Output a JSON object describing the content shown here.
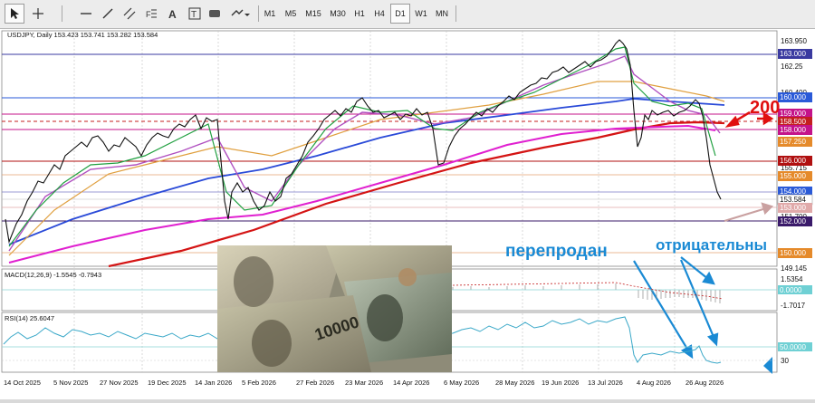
{
  "toolbar": {
    "timeframes": [
      "M1",
      "M5",
      "M15",
      "M30",
      "H1",
      "H4",
      "D1",
      "W1",
      "MN"
    ],
    "active_timeframe": "D1"
  },
  "chart": {
    "symbol_line": "USDJPY, Daily  153.423 153.741 153.282 153.584",
    "macd_label": "MACD(12,26,9) -1.5545 -0.7943",
    "rsi_label": "RSI(14) 25.6047",
    "price_axis": {
      "labels": [
        "163.950",
        "162.25",
        "160.400",
        "157.250",
        "155.715",
        "151.700",
        "149.145"
      ],
      "boxed": [
        {
          "text": "163.000",
          "color": "#3a3aa0"
        },
        {
          "text": "160.000",
          "color": "#2a5ad8"
        },
        {
          "text": "159.000",
          "color": "#c4138a"
        },
        {
          "text": "158.500",
          "color": "#c41f1f"
        },
        {
          "text": "158.000",
          "color": "#c4138a"
        },
        {
          "text": "157.250",
          "color": "#e58a2a"
        },
        {
          "text": "156.000",
          "color": "#b01010"
        },
        {
          "text": "155.000",
          "color": "#e58a2a"
        },
        {
          "text": "154.000",
          "color": "#2a5ad8"
        },
        {
          "text": "153.584",
          "color": "#ffffff"
        },
        {
          "text": "153.000",
          "color": "#e0a9a9"
        },
        {
          "text": "152.000",
          "color": "#3a1a6a"
        },
        {
          "text": "150.000",
          "color": "#e58a2a"
        }
      ]
    },
    "macd_axis": {
      "top": "1.5354",
      "zero": "0.0000",
      "bottom": "-1.7017"
    },
    "rsi_axis": {
      "fifty": "50.0000",
      "thirty": "30"
    },
    "date_labels": [
      "14 Oct 2025",
      "5 Nov 2025",
      "27 Nov 2025",
      "19 Dec 2025",
      "14 Jan 2026",
      "5 Feb 2026",
      "27 Feb 2026",
      "23 Mar 2026",
      "14 Apr 2026",
      "6 May 2026",
      "28 May 2026",
      "19 Jun 2026",
      "13 Jul 2026",
      "4 Aug 2026",
      "26 Aug 2026"
    ],
    "annotations": {
      "number_200": "200",
      "oversold": "перепродан",
      "negative": "отрицательны"
    },
    "colors": {
      "ma200": "#d41414",
      "ma_magenta": "#e020d0",
      "ma_blue": "#2a4ad8",
      "ma_orange": "#e0a040",
      "annotation_blue": "#1a8ad4"
    }
  }
}
